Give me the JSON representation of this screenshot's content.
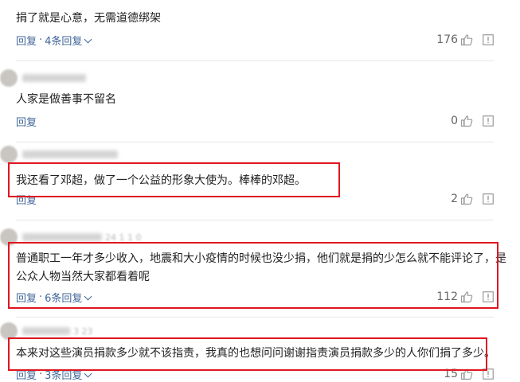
{
  "colors": {
    "link": "#406599",
    "text": "#222222",
    "count": "#666666",
    "highlight": "#e0161f"
  },
  "comments": [
    {
      "text": "捐了就是心意，无需道德绑架",
      "reply_label": "回复",
      "sep": "·",
      "replies_label": "4条回复",
      "likes": "176"
    },
    {
      "text": "人家是做善事不留名",
      "reply_label": "回复",
      "likes": "0"
    },
    {
      "text": "我还看了邓超，做了一个公益的形象大使为。棒棒的邓超。",
      "reply_label": "回复",
      "likes": "2"
    },
    {
      "text_line1": "普通职工一年才多少收入，地震和大小疫情的时候也没少捐，他们就是捐的少怎么就不能评论了，是",
      "text_line2": "公众人物当然大家都看着呢",
      "reply_label": "回复",
      "sep": "·",
      "replies_label": "6条回复",
      "likes": "112"
    },
    {
      "text": "本来对这些演员捐款多少就不该指责，我真的也想问问谢谢指责演员捐款多少的人你们捐了多少。",
      "reply_label": "回复",
      "sep": "·",
      "replies_label": "3条回复",
      "likes": "15"
    }
  ],
  "icons": {
    "like": "thumbs-up-icon",
    "report": "report-icon",
    "expand": "chevron-down-icon"
  }
}
